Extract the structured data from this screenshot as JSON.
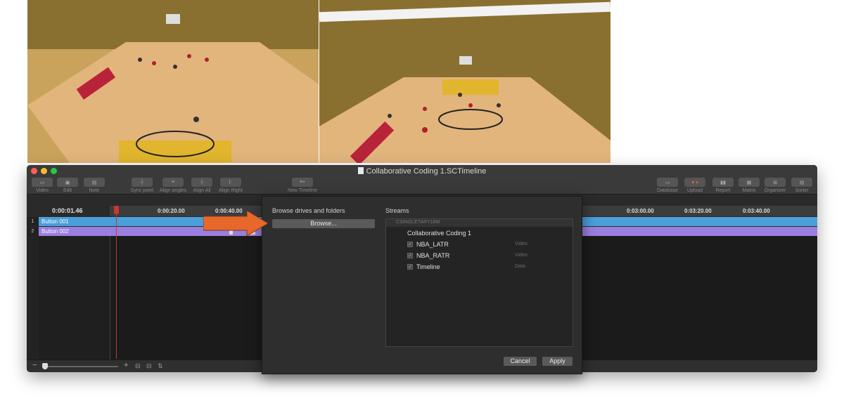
{
  "window": {
    "title": "Collaborative Coding 1.SCTimeline",
    "traffic_colors": [
      "#fe5f57",
      "#febc2e",
      "#28c840"
    ]
  },
  "toolbar": {
    "left": [
      {
        "label": "Video",
        "icon": "video-icon"
      },
      {
        "label": "Edit",
        "icon": "edit-icon"
      },
      {
        "label": "Note",
        "icon": "note-icon"
      }
    ],
    "middle": [
      {
        "label": "Sync point",
        "icon": "sync-point-icon"
      },
      {
        "label": "Align angles",
        "icon": "align-angles-icon"
      },
      {
        "label": "Align All",
        "icon": "align-all-icon"
      },
      {
        "label": "Align Right",
        "icon": "align-right-icon"
      }
    ],
    "new_timeline": {
      "label": "New Timeline",
      "icon": "new-timeline-icon"
    },
    "right": [
      {
        "label": "Database",
        "icon": "database-icon"
      },
      {
        "label": "Upload",
        "icon": "upload-icon"
      },
      {
        "label": "Report",
        "icon": "report-icon"
      },
      {
        "label": "Matrix",
        "icon": "matrix-icon"
      },
      {
        "label": "Organizer",
        "icon": "organizer-icon"
      },
      {
        "label": "Sorter",
        "icon": "sorter-icon"
      }
    ]
  },
  "timeline": {
    "current_time": "0:00:01.46",
    "ruler_left": [
      "0:00:20.00",
      "0:00:40.00"
    ],
    "ruler_right": [
      "0:03:00.00",
      "0:03:20.00",
      "0:03:40.00"
    ],
    "rows": [
      {
        "num": "1",
        "label": "Button 001",
        "color": "#4a9fd8"
      },
      {
        "num": "2",
        "label": "Button 002",
        "color": "#9a7fe0"
      }
    ]
  },
  "dialog": {
    "browse_heading": "Browse drives and folders",
    "browse_button": "Browse...",
    "streams_heading": "Streams",
    "source": "CSINGLETARY18M",
    "project": "Collaborative Coding 1",
    "streams": [
      {
        "name": "NBA_LATR",
        "type": "Video",
        "checked": true
      },
      {
        "name": "NBA_RATR",
        "type": "Video",
        "checked": true
      },
      {
        "name": "Timeline",
        "type": "Data",
        "checked": true
      }
    ],
    "cancel": "Cancel",
    "apply": "Apply"
  },
  "annotation_arrow_color": "#e8672a"
}
